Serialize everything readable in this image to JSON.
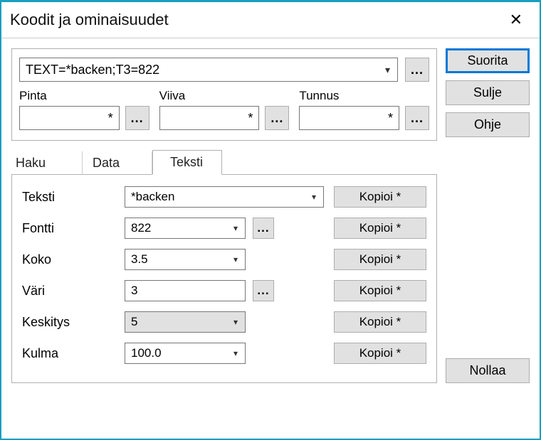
{
  "window": {
    "title": "Koodit ja ominaisuudet"
  },
  "actions": {
    "execute": "Suorita",
    "close": "Sulje",
    "help": "Ohje",
    "reset": "Nollaa",
    "ellipsis": "...",
    "close_x": "✕"
  },
  "top": {
    "expression": "TEXT=*backen;T3=822",
    "surface": {
      "label": "Pinta",
      "value": "*"
    },
    "line": {
      "label": "Viiva",
      "value": "*"
    },
    "id": {
      "label": "Tunnus",
      "value": "*"
    }
  },
  "tabs": {
    "search": "Haku",
    "data": "Data",
    "text": "Teksti"
  },
  "form": {
    "text": {
      "label": "Teksti",
      "value": "*backen",
      "copy": "Kopioi *"
    },
    "font": {
      "label": "Fontti",
      "value": "822",
      "copy": "Kopioi *"
    },
    "size": {
      "label": "Koko",
      "value": "3.5",
      "copy": "Kopioi *"
    },
    "color": {
      "label": "Väri",
      "value": "3",
      "copy": "Kopioi *"
    },
    "align": {
      "label": "Keskitys",
      "value": "5",
      "copy": "Kopioi *"
    },
    "angle": {
      "label": "Kulma",
      "value": "100.0",
      "copy": "Kopioi *"
    }
  }
}
